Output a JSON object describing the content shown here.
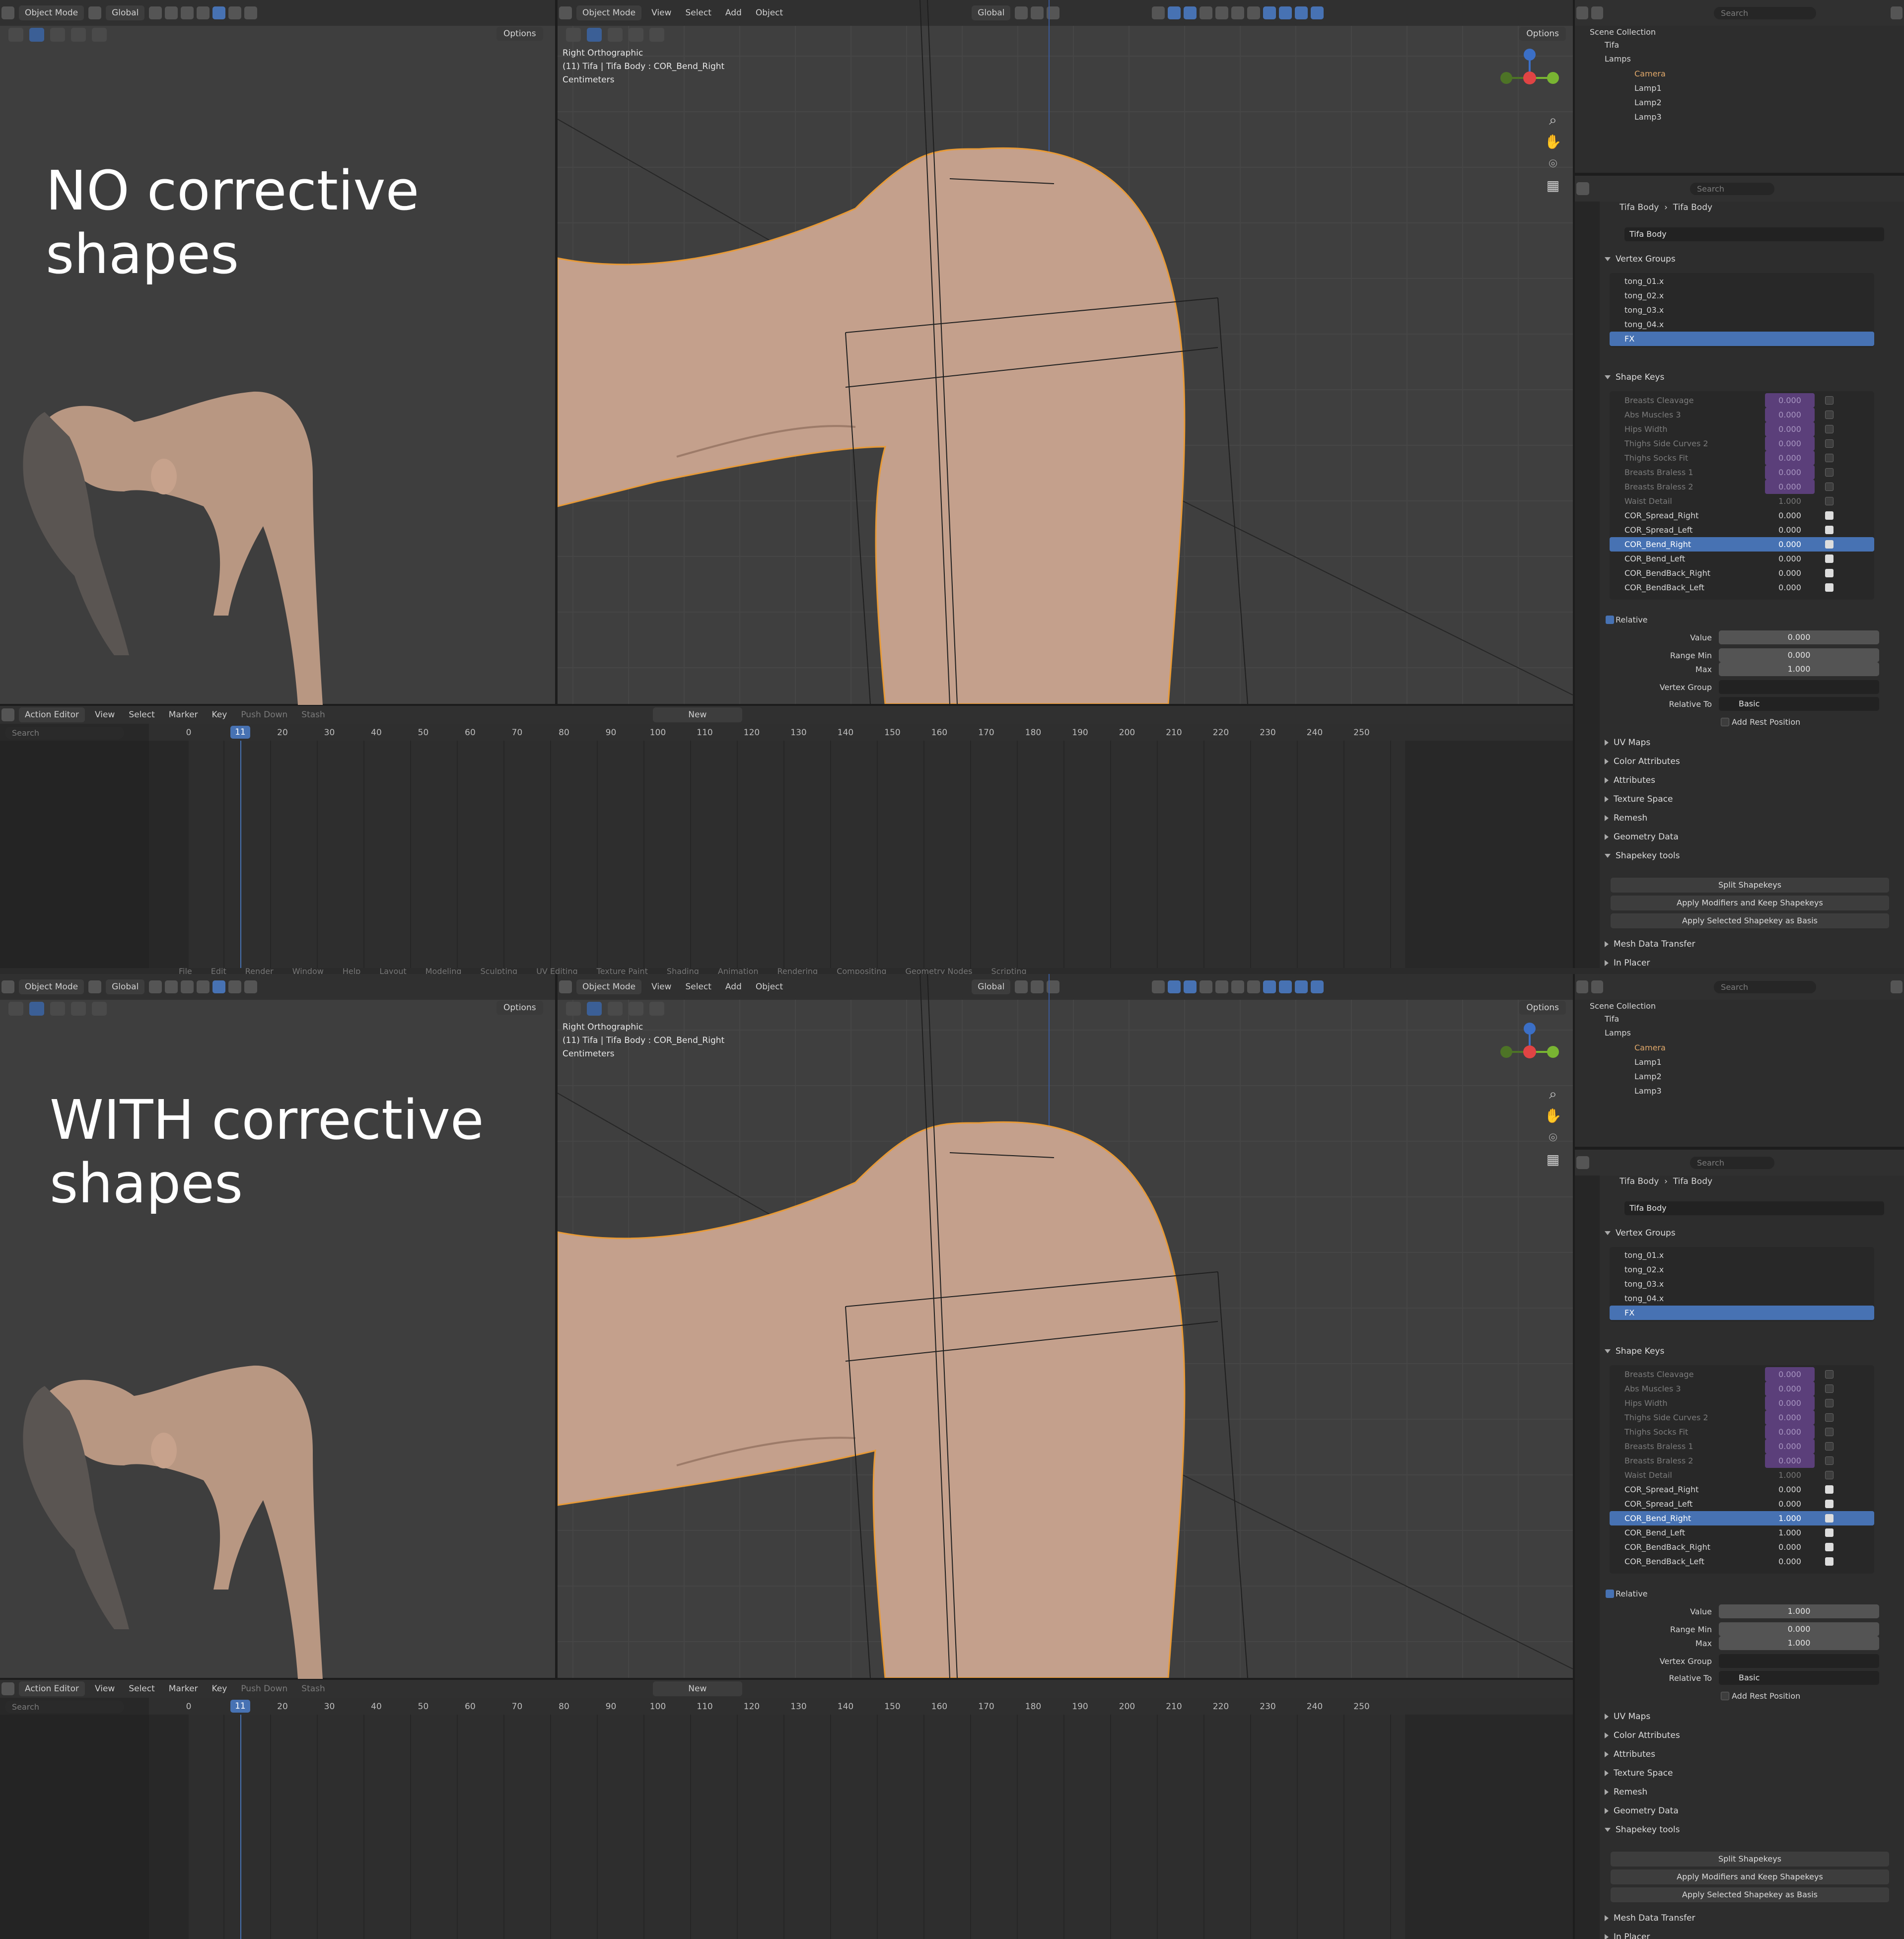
{
  "top_label": "NO corrective shapes",
  "bottom_label": "WITH corrective shapes",
  "workspace_tabs": [
    "File",
    "Edit",
    "Render",
    "Window",
    "Help",
    "Layout",
    "Modeling",
    "Sculpting",
    "UV Editing",
    "Texture Paint",
    "Shading",
    "Animation",
    "Rendering",
    "Compositing",
    "Geometry Nodes",
    "Scripting"
  ],
  "viewport_header": {
    "mode": "Object Mode",
    "orientation": "Global",
    "menus": [
      "View",
      "Select",
      "Add",
      "Object"
    ],
    "options": "Options"
  },
  "viewport_info": {
    "view": "Right Orthographic",
    "object": "(11) Tifa | Tifa Body : COR_Bend_Right",
    "units": "Centimeters"
  },
  "outliner": {
    "search_placeholder": "Search",
    "scene_collection": "Scene Collection",
    "items": [
      {
        "name": "Tifa"
      },
      {
        "name": "Lamps"
      },
      {
        "name": "Camera"
      },
      {
        "name": "Lamp1"
      },
      {
        "name": "Lamp2"
      },
      {
        "name": "Lamp3"
      }
    ]
  },
  "properties": {
    "search_placeholder": "Search",
    "breadcrumb": [
      "Tifa Body",
      "Tifa Body"
    ],
    "mesh_name": "Tifa Body",
    "vertex_groups_title": "Vertex Groups",
    "vertex_groups": [
      "tong_01.x",
      "tong_02.x",
      "tong_03.x",
      "tong_04.x",
      "FX"
    ],
    "shape_keys_title": "Shape Keys",
    "relative_label": "Relative",
    "value_label": "Value",
    "range_min_label": "Range Min",
    "max_label": "Max",
    "vertex_group_label": "Vertex Group",
    "relative_to_label": "Relative To",
    "relative_to_value": "Basic",
    "add_rest_position": "Add Rest Position",
    "sections": [
      "UV Maps",
      "Color Attributes",
      "Attributes",
      "Texture Space",
      "Remesh",
      "Geometry Data"
    ],
    "shapekey_tools_title": "Shapekey tools",
    "tool_buttons": [
      "Split Shapekeys",
      "Apply Modifiers and Keep Shapekeys",
      "Apply Selected Shapekey as Basis"
    ],
    "mesh_data_transfer": "Mesh Data Transfer",
    "in_placer": "In Placer"
  },
  "shape_keys_top": [
    {
      "name": "Breasts Cleavage",
      "value": "0.000",
      "muted": true
    },
    {
      "name": "Abs Muscles 3",
      "value": "0.000",
      "muted": true
    },
    {
      "name": "Hips Width",
      "value": "0.000",
      "muted": true
    },
    {
      "name": "Thighs Side Curves 2",
      "value": "0.000",
      "muted": true
    },
    {
      "name": "Thighs Socks Fit",
      "value": "0.000",
      "muted": true
    },
    {
      "name": "Breasts Braless 1",
      "value": "0.000",
      "muted": true
    },
    {
      "name": "Breasts Braless 2",
      "value": "0.000",
      "muted": true
    },
    {
      "name": "Waist Detail",
      "value": "1.000",
      "muted": true
    },
    {
      "name": "COR_Spread_Right",
      "value": "0.000",
      "muted": false
    },
    {
      "name": "COR_Spread_Left",
      "value": "0.000",
      "muted": false
    },
    {
      "name": "COR_Bend_Right",
      "value": "0.000",
      "muted": false,
      "selected": true
    },
    {
      "name": "COR_Bend_Left",
      "value": "0.000",
      "muted": false
    },
    {
      "name": "COR_BendBack_Right",
      "value": "0.000",
      "muted": false
    },
    {
      "name": "COR_BendBack_Left",
      "value": "0.000",
      "muted": false
    }
  ],
  "shape_keys_bottom": [
    {
      "name": "Breasts Cleavage",
      "value": "0.000",
      "muted": true
    },
    {
      "name": "Abs Muscles 3",
      "value": "0.000",
      "muted": true
    },
    {
      "name": "Hips Width",
      "value": "0.000",
      "muted": true
    },
    {
      "name": "Thighs Side Curves 2",
      "value": "0.000",
      "muted": true
    },
    {
      "name": "Thighs Socks Fit",
      "value": "0.000",
      "muted": true
    },
    {
      "name": "Breasts Braless 1",
      "value": "0.000",
      "muted": true
    },
    {
      "name": "Breasts Braless 2",
      "value": "0.000",
      "muted": true
    },
    {
      "name": "Waist Detail",
      "value": "1.000",
      "muted": true
    },
    {
      "name": "COR_Spread_Right",
      "value": "0.000",
      "muted": false
    },
    {
      "name": "COR_Spread_Left",
      "value": "0.000",
      "muted": false
    },
    {
      "name": "COR_Bend_Right",
      "value": "1.000",
      "muted": false,
      "selected": true
    },
    {
      "name": "COR_Bend_Left",
      "value": "1.000",
      "muted": false
    },
    {
      "name": "COR_BendBack_Right",
      "value": "0.000",
      "muted": false
    },
    {
      "name": "COR_BendBack_Left",
      "value": "0.000",
      "muted": false
    }
  ],
  "value_fields_top": {
    "value": "0.000",
    "range_min": "0.000",
    "max": "1.000"
  },
  "value_fields_bottom": {
    "value": "1.000",
    "range_min": "0.000",
    "max": "1.000"
  },
  "timeline": {
    "editor": "Action Editor",
    "menus": [
      "View",
      "Select",
      "Marker",
      "Key"
    ],
    "push_down": "Push Down",
    "stash": "Stash",
    "new": "New",
    "search_placeholder": "Search",
    "current_frame": "11",
    "ticks": [
      "0",
      "10",
      "20",
      "30",
      "40",
      "50",
      "60",
      "70",
      "80",
      "90",
      "100",
      "110",
      "120",
      "130",
      "140",
      "150",
      "160",
      "170",
      "180",
      "190",
      "200",
      "210",
      "220",
      "230",
      "240",
      "250"
    ]
  },
  "colors": {
    "selection": "#4772b3",
    "outline": "#e89a36",
    "skin": "#c9a08a",
    "muted_value": "#5b3f7a"
  }
}
